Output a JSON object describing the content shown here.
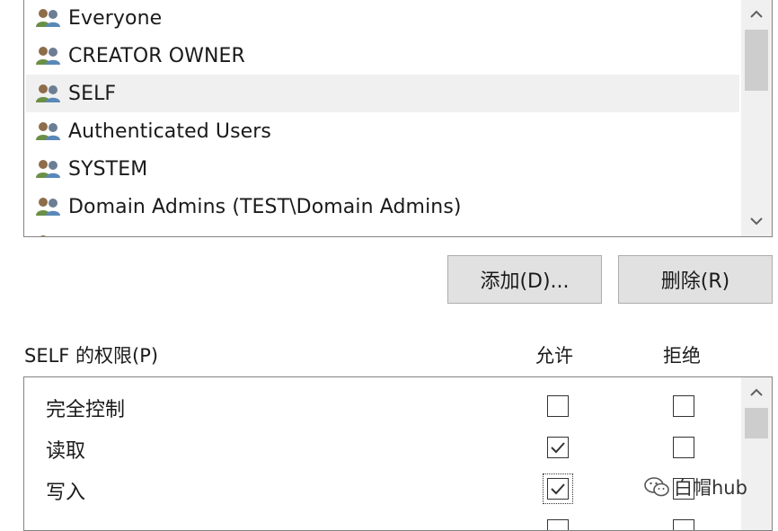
{
  "principals": {
    "items": [
      {
        "label": "Everyone",
        "selected": false
      },
      {
        "label": "CREATOR OWNER",
        "selected": false
      },
      {
        "label": "SELF",
        "selected": true
      },
      {
        "label": "Authenticated Users",
        "selected": false
      },
      {
        "label": "SYSTEM",
        "selected": false
      },
      {
        "label": "Domain Admins (TEST\\Domain Admins)",
        "selected": false
      }
    ]
  },
  "buttons": {
    "add_label": "添加(D)...",
    "remove_label": "删除(R)"
  },
  "permissions_header": {
    "title": "SELF 的权限(P)",
    "allow": "允许",
    "deny": "拒绝"
  },
  "permissions": {
    "rows": [
      {
        "name": "完全控制",
        "allow": false,
        "deny": false
      },
      {
        "name": "读取",
        "allow": true,
        "deny": false
      },
      {
        "name": "写入",
        "allow": true,
        "deny": false
      }
    ]
  },
  "watermark": {
    "text": "白帽hub",
    "icon": "wechat-icon"
  },
  "colors": {
    "selected_row": "#f0f0f0",
    "button_bg": "#e1e1e1",
    "border": "#838383",
    "scrollbar_track": "#f0f0f0",
    "scrollbar_thumb": "#cdcdcd"
  }
}
